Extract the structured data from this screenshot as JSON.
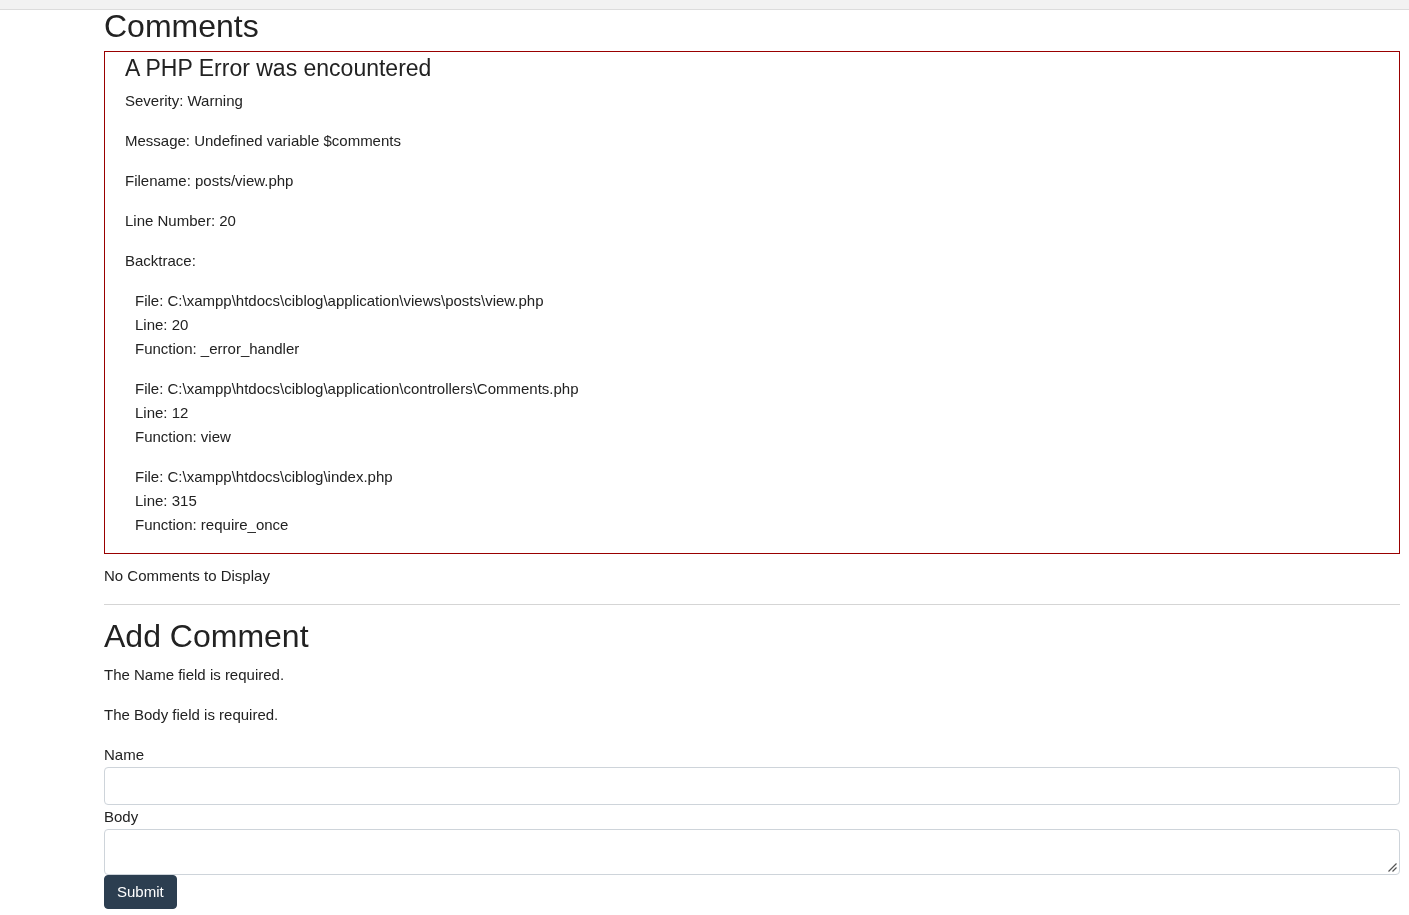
{
  "page": {
    "title": "Comments"
  },
  "php_error": {
    "title": "A PHP Error was encountered",
    "details": [
      "Severity: Warning",
      "Message: Undefined variable $comments",
      "Filename: posts/view.php",
      "Line Number: 20",
      "Backtrace:"
    ],
    "backtrace": [
      {
        "file": "File: C:\\xampp\\htdocs\\ciblog\\application\\views\\posts\\view.php",
        "line": "Line: 20",
        "function": "Function: _error_handler"
      },
      {
        "file": "File: C:\\xampp\\htdocs\\ciblog\\application\\controllers\\Comments.php",
        "line": "Line: 12",
        "function": "Function: view"
      },
      {
        "file": "File: C:\\xampp\\htdocs\\ciblog\\index.php",
        "line": "Line: 315",
        "function": "Function: require_once"
      }
    ]
  },
  "comments_message": "No Comments to Display",
  "add_comment": {
    "title": "Add Comment",
    "errors": [
      "The Name field is required.",
      "The Body field is required."
    ],
    "fields": [
      {
        "kind": "input",
        "label": "Name"
      },
      {
        "kind": "textarea",
        "label": "Body"
      }
    ],
    "submit_button": "Submit"
  }
}
